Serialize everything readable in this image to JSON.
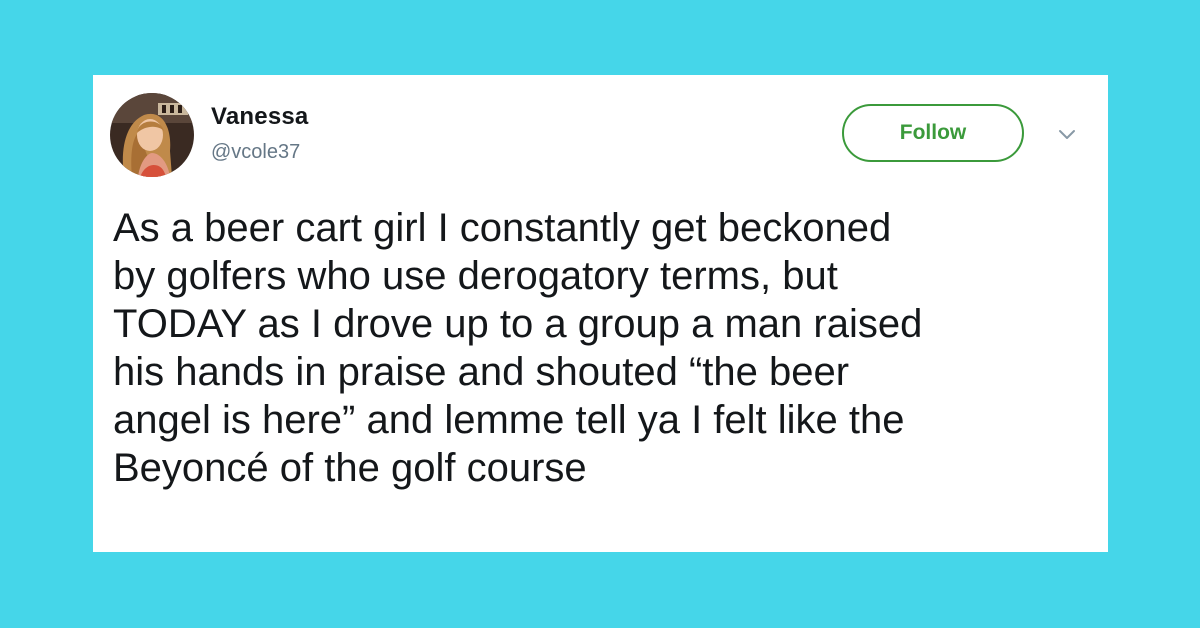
{
  "tweet": {
    "author": {
      "display_name": "Vanessa",
      "handle": "@vcole37",
      "avatar": "profile-photo"
    },
    "follow_label": "Follow",
    "more_icon": "chevron-down-icon",
    "text": "As a beer cart girl I constantly get beckoned\nby golfers who use derogatory terms, but\nTODAY as I drove up to a group a man raised\nhis hands in praise and shouted “the beer\nangel is here” and lemme tell ya I felt like the\nBeyoncé of the golf course"
  },
  "colors": {
    "page_background": "#45d6e9",
    "card_background": "#ffffff",
    "follow_accent": "#3b9a3b",
    "handle_gray": "#657786",
    "text_dark": "#14171a"
  }
}
